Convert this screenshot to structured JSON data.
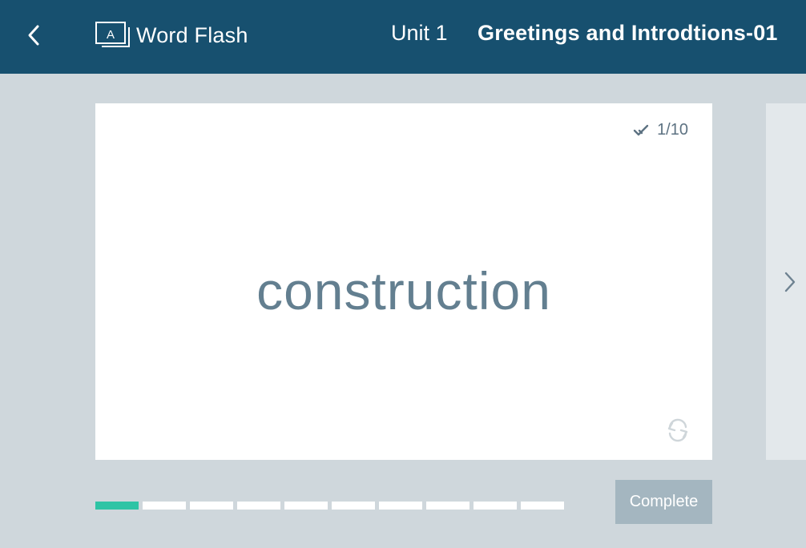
{
  "header": {
    "app_title": "Word Flash",
    "unit_label": "Unit 1",
    "lesson_title": "Greetings and Introdtions-01",
    "background_color": "#17506f",
    "icons": {
      "back": "chevron-left-icon",
      "app": "flashcard-A-icon"
    }
  },
  "card": {
    "word": "construction",
    "counter": "1/10",
    "icons": {
      "counter": "double-check-icon",
      "flip": "flip-arrows-icon"
    }
  },
  "navigation": {
    "next_icon": "chevron-right-icon"
  },
  "progress": {
    "segments": [
      {
        "completed": true
      },
      {
        "completed": false
      },
      {
        "completed": false
      },
      {
        "completed": false
      },
      {
        "completed": false
      },
      {
        "completed": false
      },
      {
        "completed": false
      },
      {
        "completed": false
      },
      {
        "completed": false
      },
      {
        "completed": false
      }
    ],
    "completed_color": "#2ec4a5"
  },
  "actions": {
    "complete_label": "Complete"
  }
}
